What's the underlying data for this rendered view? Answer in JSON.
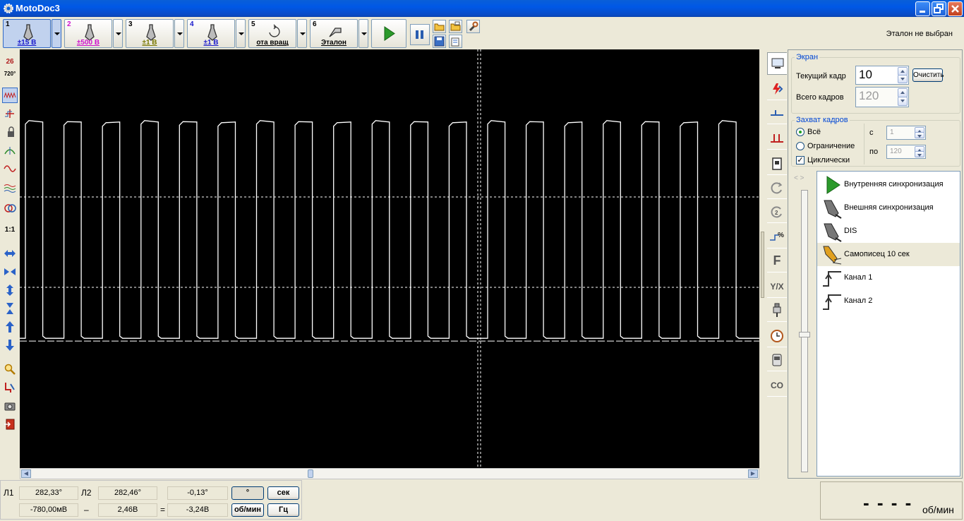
{
  "window": {
    "title": "MotoDoc3"
  },
  "toolbar": {
    "channels": [
      {
        "num": "1",
        "label": "±15 В",
        "num_color": "#000000",
        "label_color": "#1a1acc",
        "active": true
      },
      {
        "num": "2",
        "label": "±500 В",
        "num_color": "#cc11cc",
        "label_color": "#cc11cc",
        "active": false
      },
      {
        "num": "3",
        "label": "±1 В",
        "num_color": "#000000",
        "label_color": "#777700",
        "active": false
      },
      {
        "num": "4",
        "label": "±1 В",
        "num_color": "#1a1acc",
        "label_color": "#1a1acc",
        "active": false
      },
      {
        "num": "5",
        "label": "ота вращ",
        "num_color": "#000000",
        "label_color": "#000000",
        "active": false
      },
      {
        "num": "6",
        "label": "Эталон",
        "num_color": "#000000",
        "label_color": "#000000",
        "active": false
      }
    ],
    "icons": [
      "play-icon",
      "pause-icon",
      "open-folder-icon",
      "open-folder-2-icon",
      "wrench-icon",
      "save-icon",
      "export-icon"
    ],
    "etalon_status": "Эталон не выбран"
  },
  "left_tools": [
    {
      "name": "tool-26",
      "text": "26"
    },
    {
      "name": "tool-720",
      "text": "720°"
    },
    {
      "name": "tool-wave",
      "text": ""
    },
    {
      "name": "tool-cursor",
      "text": ""
    },
    {
      "name": "tool-lock",
      "text": ""
    },
    {
      "name": "tool-marker",
      "text": ""
    },
    {
      "name": "tool-sine",
      "text": ""
    },
    {
      "name": "tool-multiwave",
      "text": ""
    },
    {
      "name": "tool-overlay",
      "text": ""
    },
    {
      "name": "tool-1-1",
      "text": "1:1"
    }
  ],
  "screen": {
    "legend": "Экран",
    "current_frame_label": "Текущий кадр",
    "current_frame_value": "10",
    "clear_button": "Очистить",
    "total_frames_label": "Всего кадров",
    "total_frames_value": "120"
  },
  "capture": {
    "legend": "Захват кадров",
    "option_all": "Всё",
    "option_limit": "Ограничение",
    "cyclic_label": "Циклически",
    "cyclic_checked": true,
    "from_label": "с",
    "from_value": "1",
    "to_label": "по",
    "to_value": "120"
  },
  "sync_list": [
    {
      "label": "Внутренняя синхронизация",
      "icon": "play-triangle-icon",
      "selected": false
    },
    {
      "label": "Внешняя синхронизация",
      "icon": "probe-icon",
      "selected": false
    },
    {
      "label": "DIS",
      "icon": "probe-icon",
      "selected": false
    },
    {
      "label": "Самописец 10 сек",
      "icon": "recorder-pen-icon",
      "selected": true
    },
    {
      "label": "Канал 1",
      "icon": "rising-edge-icon",
      "selected": false
    },
    {
      "label": "Канал 2",
      "icon": "rising-edge-icon",
      "selected": false
    }
  ],
  "right_tabs": [
    "monitor-icon",
    "lightning-icon",
    "falling-edge-icon",
    "pulse-icon",
    "book-icon",
    "rotation-icon",
    "rotation-2-icon",
    "percent-icon",
    "F",
    "Y/X",
    "spark-plug-icon",
    "clock-icon",
    "device-icon",
    "CO"
  ],
  "measurements": {
    "l1_label": "Л1",
    "l1_angle": "282,33°",
    "l2_label": "Л2",
    "l2_angle": "282,46°",
    "diff_angle": "-0,13°",
    "l1_volt": "-780,00мВ",
    "minus_sign": "–",
    "l2_volt": "2,46В",
    "equals_sign": "=",
    "diff_volt": "-3,24В",
    "unit_deg": "°",
    "unit_sec": "сек",
    "unit_rpm": "об/мин",
    "unit_hz": "Гц"
  },
  "rpm_display": {
    "value": "- - - -",
    "unit": "об/мин"
  },
  "colors": {
    "title_bar": "#0a5fd8",
    "scope_bg": "#000000",
    "trace": "#ffffff",
    "accent": "#0046d5"
  },
  "scope": {
    "pulse_count": 19,
    "high_level_percent": 83,
    "low_level_percent": 31
  }
}
